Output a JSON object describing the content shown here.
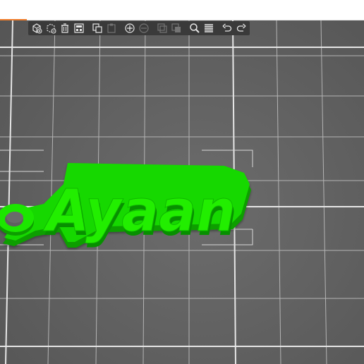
{
  "app": {
    "accent_color": "#ef7d2d",
    "background_color": "#ffffff"
  },
  "toolbar": {
    "buttons": [
      {
        "name": "add-object-icon",
        "enabled": true
      },
      {
        "name": "delete-icon",
        "enabled": true
      },
      {
        "name": "delete-all-icon",
        "enabled": true
      },
      {
        "name": "arrange-icon",
        "enabled": true
      },
      {
        "name": "copy-icon",
        "enabled": true
      },
      {
        "name": "paste-icon",
        "enabled": false
      },
      {
        "name": "add-instance-icon",
        "enabled": true
      },
      {
        "name": "remove-instance-icon",
        "enabled": false
      },
      {
        "name": "split-to-objects-icon",
        "enabled": false
      },
      {
        "name": "split-to-parts-icon",
        "enabled": false
      },
      {
        "name": "search-icon",
        "enabled": true
      },
      {
        "name": "layers-editing-icon",
        "enabled": true
      },
      {
        "name": "undo-icon",
        "enabled": true
      },
      {
        "name": "redo-icon",
        "enabled": true
      }
    ]
  },
  "scene": {
    "model_text": "Ayaan",
    "model_color": "#1ee600",
    "bed_color": "#5e5e5e",
    "grid_color": "#bdbdbd"
  }
}
